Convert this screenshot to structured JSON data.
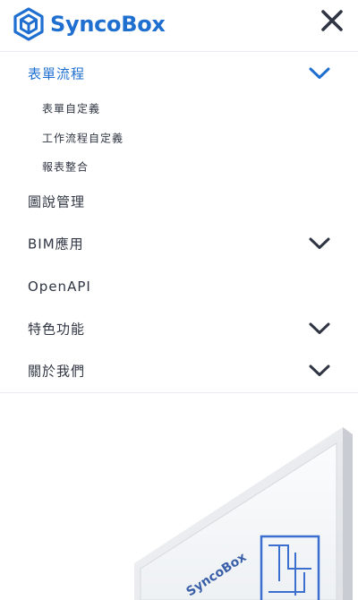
{
  "brand": {
    "name": "SyncoBox",
    "color": "#1f6fd1"
  },
  "header": {
    "logo_icon": "cube-logo-icon",
    "close_icon": "close-icon"
  },
  "menu": {
    "items": [
      {
        "label": "表單流程",
        "expanded": true,
        "has_submenu": true,
        "icon": "chevron-down-icon"
      },
      {
        "label": "圖說管理",
        "has_submenu": false
      },
      {
        "label": "BIM應用",
        "has_submenu": true,
        "icon": "chevron-down-icon"
      },
      {
        "label": "OpenAPI",
        "has_submenu": false
      },
      {
        "label": "特色功能",
        "has_submenu": true,
        "icon": "chevron-down-icon"
      },
      {
        "label": "關於我們",
        "has_submenu": true,
        "icon": "chevron-down-icon"
      }
    ],
    "sub_items": [
      {
        "label": "表單自定義"
      },
      {
        "label": "工作流程自定義"
      },
      {
        "label": "報表整合"
      }
    ]
  },
  "hero": {
    "device_brand": "SyncoBox"
  },
  "colors": {
    "accent": "#1f6fd1",
    "text": "#2f3542",
    "divider": "#e8ecf1"
  }
}
